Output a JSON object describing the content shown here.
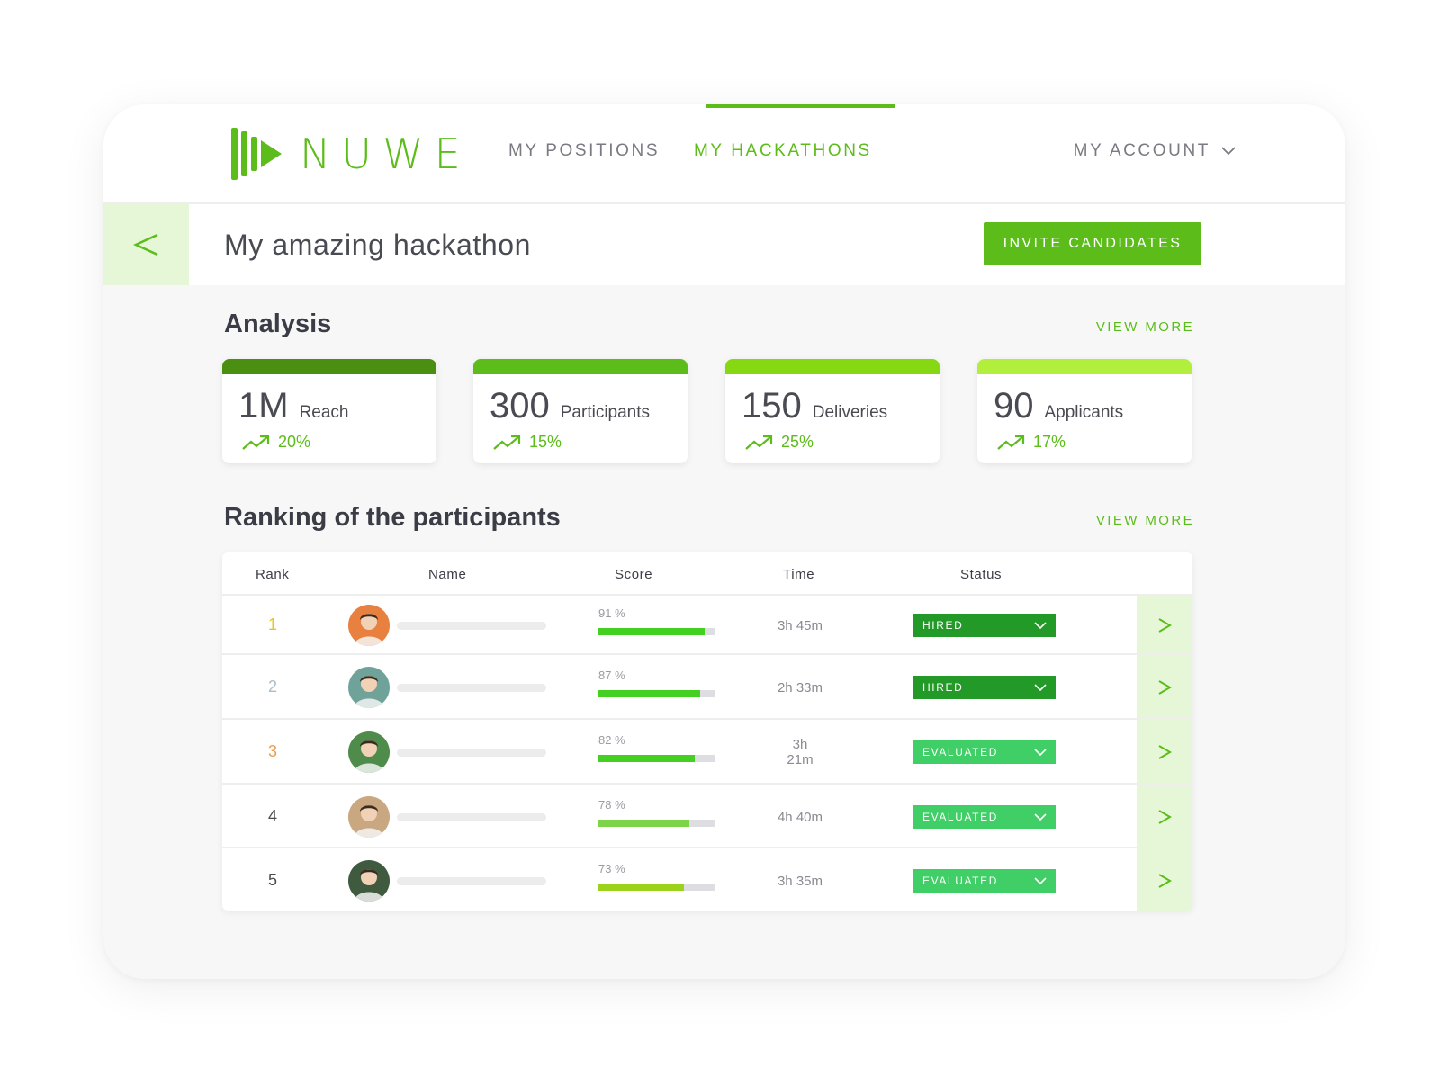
{
  "brand": {
    "name": "NUWE",
    "color": "#5cbd1a"
  },
  "nav": {
    "positions": "MY POSITIONS",
    "hackathons": "MY HACKATHONS",
    "account": "MY ACCOUNT",
    "active": "hackathons"
  },
  "header": {
    "back_icon": "chevron-left-icon",
    "title": "My amazing hackathon",
    "invite_label": "INVITE CANDIDATES"
  },
  "analysis": {
    "title": "Analysis",
    "view_more": "VIEW MORE",
    "cards": [
      {
        "value": "1M",
        "label": "Reach",
        "trend": "20%",
        "bar_color": "#4a8f12"
      },
      {
        "value": "300",
        "label": "Participants",
        "trend": "15%",
        "bar_color": "#5cbd1a"
      },
      {
        "value": "150",
        "label": "Deliveries",
        "trend": "25%",
        "bar_color": "#86d813"
      },
      {
        "value": "90",
        "label": "Applicants",
        "trend": "17%",
        "bar_color": "#b2ef3c"
      }
    ]
  },
  "ranking": {
    "title": "Ranking of the participants",
    "view_more": "VIEW MORE",
    "columns": {
      "rank": "Rank",
      "name": "Name",
      "score": "Score",
      "time": "Time",
      "status": "Status"
    },
    "rows": [
      {
        "rank": "1",
        "rank_color": "#e6c52a",
        "avatar_color": "#e8803f",
        "score_label": "91 %",
        "score": 0.91,
        "score_color": "#44d020",
        "time": "3h 45m",
        "status": "HIRED",
        "status_color": "#239a28"
      },
      {
        "rank": "2",
        "rank_color": "#a9bdcb",
        "avatar_color": "#6fa39a",
        "score_label": "87 %",
        "score": 0.87,
        "score_color": "#44d020",
        "time": "2h 33m",
        "status": "HIRED",
        "status_color": "#239a28"
      },
      {
        "rank": "3",
        "rank_color": "#ef9a4a",
        "avatar_color": "#4f8b4a",
        "score_label": "82 %",
        "score": 0.82,
        "score_color": "#44d020",
        "time": "3h 21m",
        "status": "EVALUATED",
        "status_color": "#3fcf66"
      },
      {
        "rank": "4",
        "rank_color": "#4a4a52",
        "avatar_color": "#c9a781",
        "score_label": "78 %",
        "score": 0.78,
        "score_color": "#7dd448",
        "time": "4h 40m",
        "status": "EVALUATED",
        "status_color": "#3fcf66"
      },
      {
        "rank": "5",
        "rank_color": "#4a4a52",
        "avatar_color": "#3f5a3f",
        "score_label": "73 %",
        "score": 0.73,
        "score_color": "#9bd31c",
        "time": "3h 35m",
        "status": "EVALUATED",
        "status_color": "#3fcf66"
      }
    ]
  }
}
